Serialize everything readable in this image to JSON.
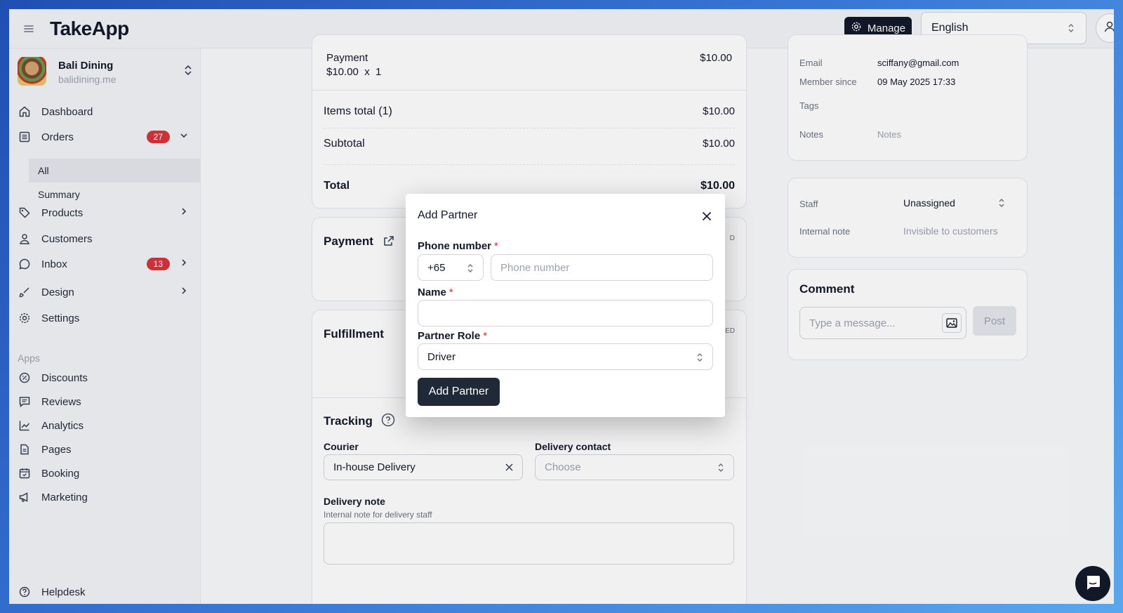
{
  "app": {
    "logo": "TakeApp"
  },
  "header": {
    "manage_label": "Manage",
    "language": "English"
  },
  "store": {
    "name": "Bali Dining",
    "url": "balidining.me"
  },
  "sidebar": {
    "items": [
      {
        "label": "Dashboard"
      },
      {
        "label": "Orders",
        "badge": "27"
      },
      {
        "label": "Products"
      },
      {
        "label": "Customers"
      },
      {
        "label": "Inbox",
        "badge": "13"
      },
      {
        "label": "Design"
      },
      {
        "label": "Settings"
      }
    ],
    "orders_sub": [
      "All",
      "Summary"
    ],
    "apps_label": "Apps",
    "apps": [
      {
        "label": "Discounts"
      },
      {
        "label": "Reviews"
      },
      {
        "label": "Analytics"
      },
      {
        "label": "Pages"
      },
      {
        "label": "Booking"
      },
      {
        "label": "Marketing"
      }
    ],
    "helpdesk": "Helpdesk"
  },
  "order": {
    "item_name": "Payment",
    "item_qty": "$10.00  x  1",
    "item_price": "$10.00",
    "items_total_label": "Items total (1)",
    "items_total": "$10.00",
    "subtotal_label": "Subtotal",
    "subtotal": "$10.00",
    "total_label": "Total",
    "total": "$10.00",
    "payment_title": "Payment",
    "payment_status": "D",
    "fulfillment_title": "Fulfillment",
    "fulfillment_status": "ED"
  },
  "tracking": {
    "title": "Tracking",
    "courier_label": "Courier",
    "courier_value": "In-house Delivery",
    "contact_label": "Delivery contact",
    "contact_placeholder": "Choose",
    "note_label": "Delivery note",
    "note_hint": "Internal note for delivery staff"
  },
  "customer": {
    "email_label": "Email",
    "email": "sciffany@gmail.com",
    "member_label": "Member since",
    "member_since": "09 May 2025 17:33",
    "tags_label": "Tags",
    "notes_label": "Notes",
    "notes_placeholder": "Notes"
  },
  "staff": {
    "staff_label": "Staff",
    "staff_value": "Unassigned",
    "note_label": "Internal note",
    "note_placeholder": "Invisible to customers"
  },
  "comment": {
    "title": "Comment",
    "placeholder": "Type a message...",
    "post_label": "Post"
  },
  "modal": {
    "title": "Add Partner",
    "phone_label": "Phone number",
    "country_code": "+65",
    "phone_placeholder": "Phone number",
    "name_label": "Name",
    "role_label": "Partner Role",
    "role_value": "Driver",
    "required_mark": "*",
    "submit_label": "Add Partner"
  }
}
